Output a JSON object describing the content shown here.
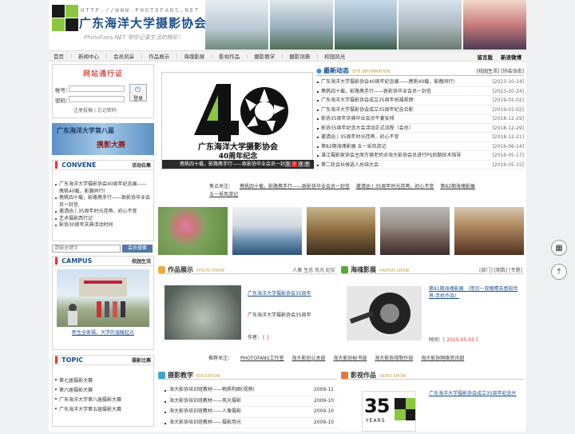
{
  "header": {
    "url_text": "HTTP://WWW.PHOTOFANS.NET",
    "title": "广东海洋大学摄影协会",
    "slogan": "PhotoFans.NET 带你记录生活的精彩！"
  },
  "nav": {
    "items": [
      "首页",
      "新闻中心",
      "会员风采",
      "作品展示",
      "海魂影展",
      "影视作品",
      "摄影教学",
      "摄影词典",
      "校园风光"
    ],
    "right": [
      "留言版",
      "新浪微博"
    ]
  },
  "login": {
    "title": "网站通行证",
    "account_label": "帐号：",
    "password_label": "密码：",
    "login_button": "登录",
    "register_link": "注册投稿",
    "forgot_link": "忘记密码"
  },
  "banner": {
    "line1": "广东海洋大学第八届",
    "line2": "携影大赛"
  },
  "convene": {
    "title": "CONVENE",
    "more": "活动召集",
    "items": [
      "广东海洋大学摄影协会40周年纪念展——携帆40载，影路同行!",
      "携帆四十载，影路携手行——致影协毕业会员一封信",
      "邀请函 | 35周年时光荏苒，初心不变",
      "艺术摄影西行记",
      "影协30周年庆典活动时间"
    ]
  },
  "search": {
    "placeholder": "请输关键字",
    "button": "会员搜索"
  },
  "campus": {
    "title": "CAMPUS",
    "more": "校园生活",
    "caption": "新生全家福，大学的温暖起点"
  },
  "topic": {
    "title": "TOPIC",
    "more": "摄影比赛",
    "items": [
      "第七届摄影大赛",
      "第六届摄影大赛",
      "广东海洋大学第八届摄影大赛",
      "广东海洋大学第五届摄影大赛"
    ]
  },
  "focus": {
    "caption_line1": "广东海洋大学摄影协会",
    "caption_line2": "40周年纪念",
    "bar_text": "携帆四十载，影路携手行——致影协毕业会员一封信",
    "dots": [
      "1",
      "2",
      "3",
      "4"
    ]
  },
  "news": {
    "title": "最新动态",
    "subtitle": "SITE INFORMATION",
    "links": [
      "[校园生活]",
      "[协会动态]"
    ],
    "items": [
      {
        "title": "广东海洋大学摄影协会40周年纪念展——携帆40载，影路同行!",
        "date": "[2023-10-24]"
      },
      {
        "title": "携帆四十载，影路携手行——致影协毕业会员一封信",
        "date": "[2023-10-24]"
      },
      {
        "title": "广东海洋大学摄影协会成立35周年祝福视频",
        "date": "[2019-01-02]"
      },
      {
        "title": "广东海洋大学摄影协会成立35周年纪念合影",
        "date": "[2019-01-02]"
      },
      {
        "title": "影协35周年庆典毕业会员午宴安排",
        "date": "[2018-12-29]"
      },
      {
        "title": "影协35周年纪念大会活动正式流程（会员）",
        "date": "[2018-12-29]"
      },
      {
        "title": "邀请函 | 35周年时光荏苒，初心不变",
        "date": "[2018-12-21]"
      },
      {
        "title": "第82期海魂影展 五一采风游记",
        "date": "[2016-06-14]"
      },
      {
        "title": "湛江摄影家协会主席万德老师对海大影协会员进行PS后期技术指导",
        "date": "[2016-05-17]"
      },
      {
        "title": "第二轮会长候选人总结大会",
        "date": "[2016-05-15]"
      }
    ]
  },
  "notice": {
    "label": "焦点关注：",
    "items": [
      "携帆四十载，影路携手行——致影协毕业会员一封信",
      "邀请函 | 35周年时光荏苒，初心不变",
      "第82期海魂影展",
      "五一采风游记"
    ]
  },
  "works": {
    "title": "作品展示",
    "subtitle": "PHOTO SHOW",
    "tags": "人像 生态 风光 纪实",
    "item_title": "广东海洋大学摄影协会35周年",
    "item_desc": "广东海洋大学摄影协会35周年",
    "author_label": "作者：",
    "author": "{ }"
  },
  "haihun": {
    "title": "海魂影展",
    "subtitle": "HAIHUN SHOW",
    "tabs": "[部门]  [期数]  [专题]",
    "item_title": "第81期海魂影展 （用另一双眼睛去感知世界-手机作品）",
    "time_label": "时间：",
    "time": "[ 2015-05-05 ]"
  },
  "recommend": {
    "label": "推荐关注：",
    "items": [
      "PHOTOFANS工作室",
      "海大影协公关部",
      "海大影协秘书部",
      "海大影协视制作部",
      "海大影协网络资讯部"
    ]
  },
  "teaching": {
    "title": "摄影教学",
    "subtitle": "EDUCATION",
    "items": [
      {
        "title": "海大影协培训班教材——物质构图(视频)",
        "date": "2009-11"
      },
      {
        "title": "海大影协培训班教材——风光摄影",
        "date": "2009-10"
      },
      {
        "title": "海大影协培训班教材——人像摄影",
        "date": "2009-10"
      },
      {
        "title": "海大影协培训班教材——摄影用光",
        "date": "2009-10"
      }
    ]
  },
  "video": {
    "title": "影视作品",
    "subtitle": "VIDEO SHOW",
    "item_title": "广东海洋大学摄影协会成立35周年纪念片",
    "badge_number": "35",
    "badge_text": "YEARS"
  },
  "side": {
    "qr": "qr-icon",
    "top": "back-to-top-icon"
  },
  "colors": {
    "brand_blue": "#1a4e8c",
    "accent_red": "#dd3333",
    "accent_green": "#8cc63f"
  }
}
